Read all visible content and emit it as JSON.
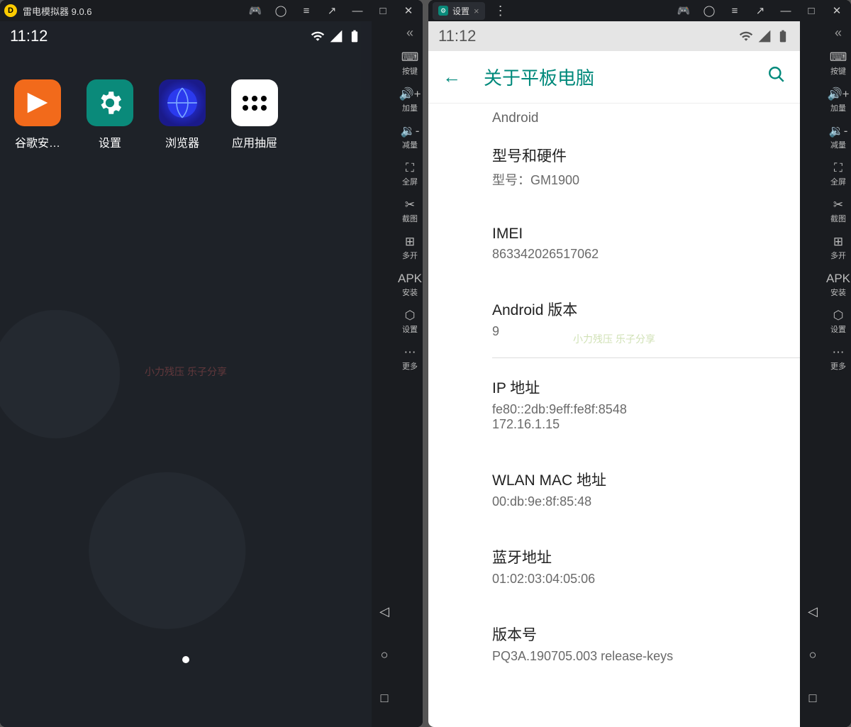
{
  "emulator_title": "雷电模拟器 9.0.6",
  "sidebar_items": [
    {
      "icon": "⌨",
      "label": "按键"
    },
    {
      "icon": "🔊+",
      "label": "加量"
    },
    {
      "icon": "🔉-",
      "label": "减量"
    },
    {
      "icon": "⛶",
      "label": "全屏"
    },
    {
      "icon": "✂",
      "label": "截图"
    },
    {
      "icon": "⊞",
      "label": "多开"
    },
    {
      "icon": "APK",
      "label": "安装"
    },
    {
      "icon": "⬡",
      "label": "设置"
    },
    {
      "icon": "⋯",
      "label": "更多"
    }
  ],
  "statusbar_time": "11:12",
  "home": {
    "apps": [
      {
        "id": "google",
        "label": "谷歌安…"
      },
      {
        "id": "settings",
        "label": "设置"
      },
      {
        "id": "browser",
        "label": "浏览器"
      },
      {
        "id": "drawer",
        "label": "应用抽屉"
      }
    ],
    "watermark": "小力残压  乐子分享"
  },
  "settings_tab": {
    "label": "设置"
  },
  "settings_page": {
    "header_title": "关于平板电脑",
    "top_text": "Android",
    "items": [
      {
        "title": "型号和硬件",
        "value": "型号：GM1900",
        "section_end": false
      },
      {
        "title": "IMEI",
        "value": "863342026517062",
        "section_end": false
      },
      {
        "title": "Android 版本",
        "value": "9",
        "section_end": true
      },
      {
        "title": "IP 地址",
        "value": "fe80::2db:9eff:fe8f:8548\n172.16.1.15",
        "section_end": false
      },
      {
        "title": "WLAN MAC 地址",
        "value": "00:db:9e:8f:85:48",
        "section_end": false
      },
      {
        "title": "蓝牙地址",
        "value": "01:02:03:04:05:06",
        "section_end": false
      },
      {
        "title": "版本号",
        "value": "PQ3A.190705.003 release-keys",
        "section_end": false
      }
    ]
  }
}
